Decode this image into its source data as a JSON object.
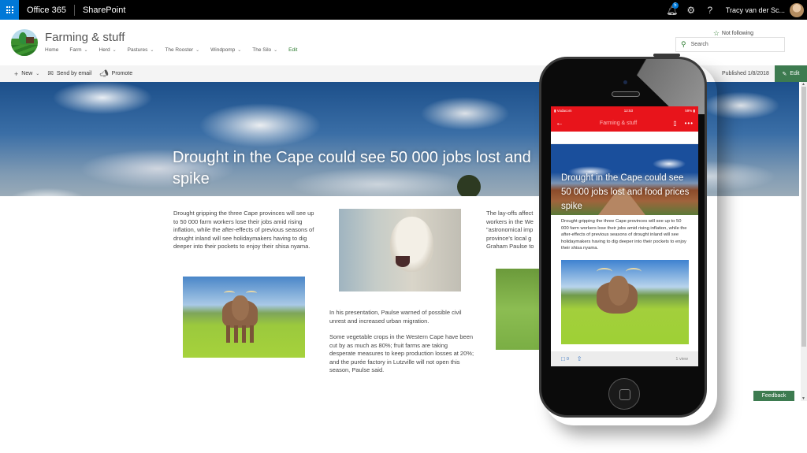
{
  "suitebar": {
    "app_launcher_icon": "waffle-icon",
    "brand": "Office 365",
    "app_name": "SharePoint",
    "notifications_icon": "bell-icon",
    "notifications_count": "5",
    "settings_icon": "gear-icon",
    "help_label": "?",
    "user_name": "Tracy van der Sc..."
  },
  "site": {
    "title": "Farming & stuff",
    "nav": [
      {
        "label": "Home",
        "has_dropdown": false
      },
      {
        "label": "Farm",
        "has_dropdown": true
      },
      {
        "label": "Herd",
        "has_dropdown": true
      },
      {
        "label": "Pastures",
        "has_dropdown": true
      },
      {
        "label": "The Rooster",
        "has_dropdown": true
      },
      {
        "label": "Windpomp",
        "has_dropdown": true
      },
      {
        "label": "The Silo",
        "has_dropdown": true
      }
    ],
    "nav_edit": "Edit",
    "follow_label": "Not following",
    "search_placeholder": "Search"
  },
  "commandbar": {
    "new_label": "New",
    "send_email_label": "Send by email",
    "promote_label": "Promote",
    "published": "Published 1/8/2018",
    "edit_label": "Edit"
  },
  "article": {
    "title": "Drought in the Cape could see 50 000 jobs lost and food prices spike",
    "title_visible": "Drought in the Cape could see 50 000 jobs lost and spike",
    "p1": "Drought gripping the three Cape provinces will see up to 50 000 farm workers lose their jobs amid rising inflation, while the after-effects of previous seasons of drought inland will see holidaymakers having to dig deeper into their pockets to enjoy their shisa nyama.",
    "p2": "In his presentation, Paulse warned of possible civil unrest and increased urban migration.",
    "p3": "Some vegetable crops in the Western Cape have been cut by as much as 80%; fruit farms are taking desperate measures to keep production losses at 20%; and the purée factory in Lutzville will not open this season, Paulse said.",
    "p4_lines": [
      "The lay-offs affect",
      "workers in the We",
      "\"astronomical imp",
      "province's local g",
      "Graham Paulse to"
    ]
  },
  "feedback_label": "Feedback",
  "mobile": {
    "carrier": "Vodacom",
    "time": "12:53",
    "battery": "59%",
    "app_title": "Farming & stuff",
    "hero_title": "Drought in the Cape could see 50 000 jobs lost and food prices spike",
    "body": "Drought gripping the three Cape provinces will see up to 50 000 farm workers lose their jobs amid rising inflation, while the after-effects of previous seasons of drought inland will see holidaymakers having to dig deeper into their pockets to enjoy their shisa nyama.",
    "comment_count": "0",
    "views": "1 view"
  }
}
